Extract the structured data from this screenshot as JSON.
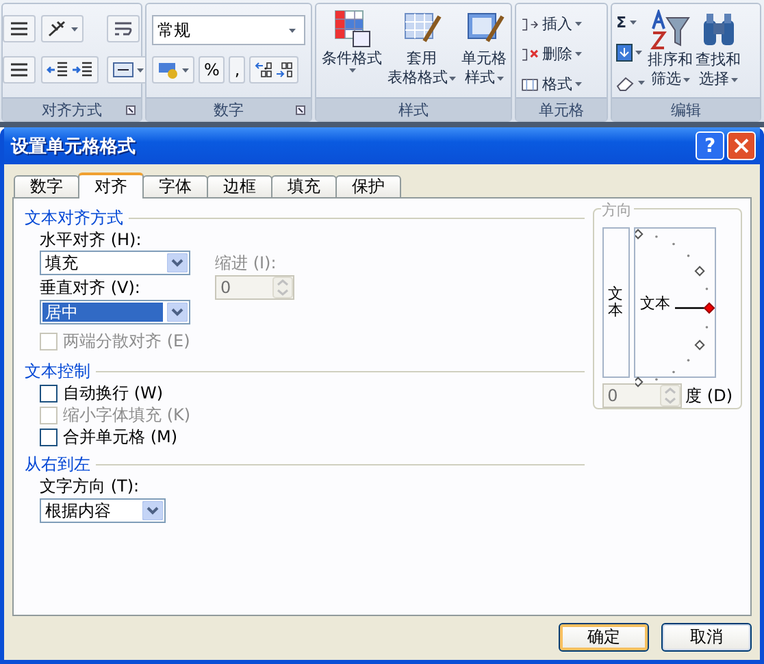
{
  "ribbon": {
    "alignment_group": {
      "label": "对齐方式"
    },
    "number_group": {
      "label": "数字",
      "format": "常规",
      "percent": "%",
      "comma": ","
    },
    "styles_group": {
      "label": "样式",
      "buttons": [
        {
          "lines": [
            "条件格式"
          ],
          "kind": "conditional"
        },
        {
          "lines": [
            "套用",
            "表格格式"
          ],
          "kind": "table"
        },
        {
          "lines": [
            "单元格",
            "样式"
          ],
          "kind": "cellstyle"
        }
      ]
    },
    "cells_group": {
      "label": "单元格",
      "buttons": [
        {
          "label": "插入",
          "kind": "insert"
        },
        {
          "label": "删除",
          "kind": "delete"
        },
        {
          "label": "格式",
          "kind": "format"
        }
      ]
    },
    "editing_group": {
      "label": "编辑",
      "sum": "Σ",
      "buttons": [
        {
          "lines": [
            "排序和",
            "筛选"
          ],
          "kind": "sort"
        },
        {
          "lines": [
            "查找和",
            "选择"
          ],
          "kind": "find"
        }
      ]
    }
  },
  "dialog": {
    "title": "设置单元格格式",
    "help": "?",
    "tabs": [
      {
        "label": "数字",
        "selected": false
      },
      {
        "label": "对齐",
        "selected": true
      },
      {
        "label": "字体",
        "selected": false
      },
      {
        "label": "边框",
        "selected": false
      },
      {
        "label": "填充",
        "selected": false
      },
      {
        "label": "保护",
        "selected": false
      }
    ],
    "alignment": {
      "heading": "文本对齐方式",
      "horizontal": {
        "label": "水平对齐 (H):",
        "value": "填充",
        "highlighted": false
      },
      "indent": {
        "label": "缩进 (I):",
        "value": "0",
        "disabled": true
      },
      "vertical": {
        "label": "垂直对齐 (V):",
        "value": "居中",
        "highlighted": true
      },
      "distributed": {
        "label": "两端分散对齐 (E)",
        "checked": false,
        "disabled": true
      }
    },
    "text_control": {
      "heading": "文本控制",
      "options": [
        {
          "label": "自动换行 (W)",
          "checked": false,
          "disabled": false
        },
        {
          "label": "缩小字体填充 (K)",
          "checked": false,
          "disabled": true
        },
        {
          "label": "合并单元格 (M)",
          "checked": false,
          "disabled": false
        }
      ]
    },
    "right_to_left": {
      "heading": "从右到左",
      "direction": {
        "label": "文字方向 (T):",
        "value": "根据内容",
        "highlighted": false
      }
    },
    "orientation": {
      "heading": "方向",
      "vertical_text": "文本",
      "text": "文本",
      "degrees": {
        "value": "0",
        "label": "度 (D)",
        "disabled": true
      }
    },
    "buttons": [
      {
        "label": "确定",
        "default": true
      },
      {
        "label": "取消",
        "default": false
      }
    ]
  }
}
